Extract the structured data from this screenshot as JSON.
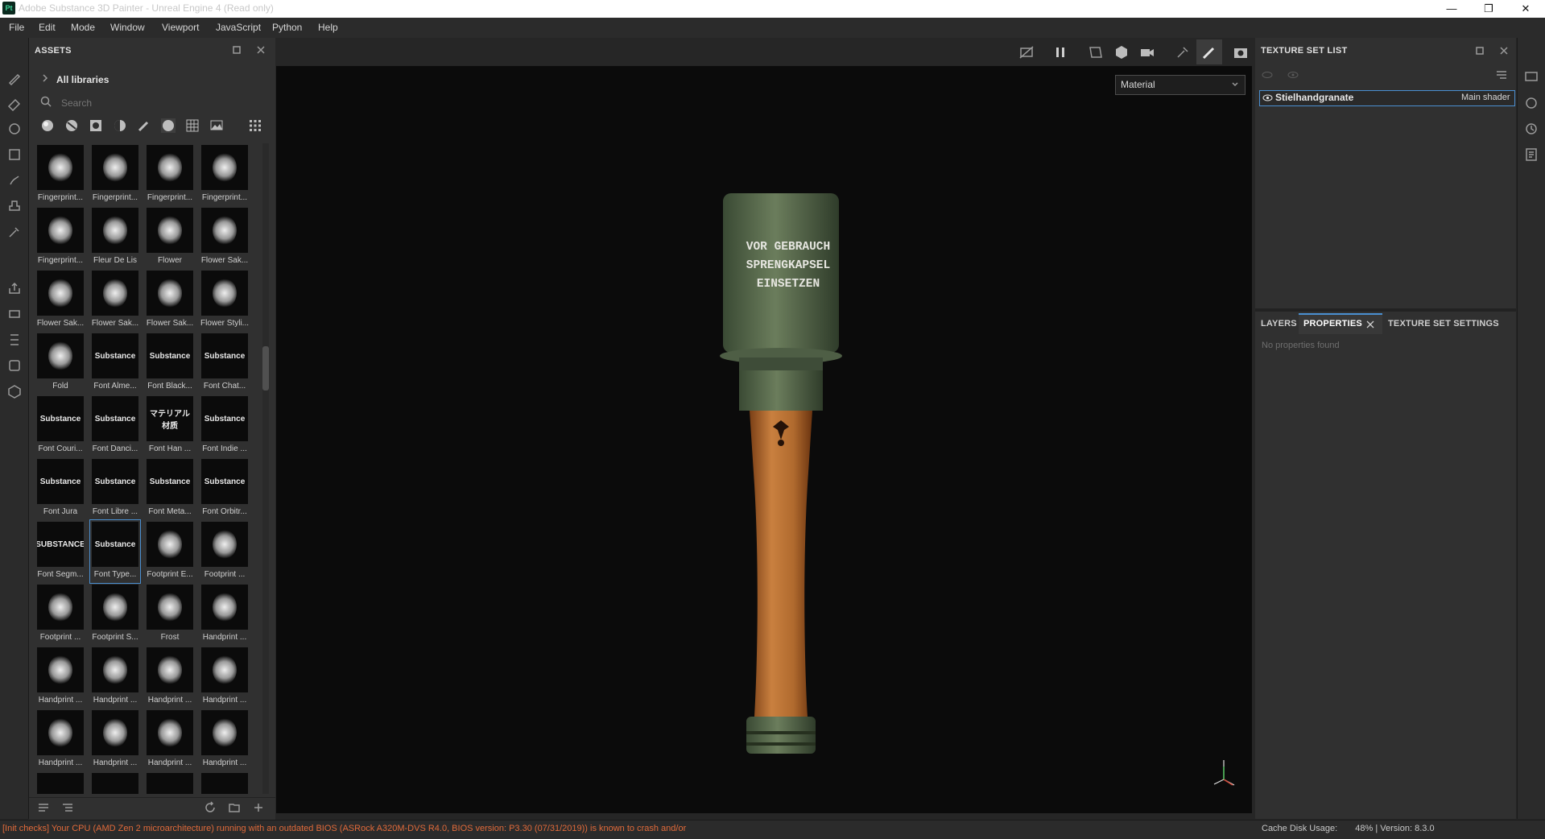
{
  "window": {
    "app_logo": "Pt",
    "title": "Adobe Substance 3D Painter - Unreal Engine 4 (Read only)",
    "controls": {
      "minimize": "—",
      "maximize": "❐",
      "close": "✕"
    }
  },
  "menu": [
    "File",
    "Edit",
    "Mode",
    "Window",
    "Viewport",
    "JavaScript",
    "Python",
    "Help"
  ],
  "left_toolbar_icons": [
    "paint-brush-icon",
    "eraser-icon",
    "projection-icon",
    "geometry-mask-icon",
    "smudge-icon",
    "clone-stamp-icon",
    "color-picker-icon",
    "export-icon",
    "bake-icon",
    "ruler-icon",
    "shelf-icon",
    "3d-icon"
  ],
  "assets": {
    "title": "ASSETS",
    "all_libraries": "All libraries",
    "search_placeholder": "Search",
    "filters": [
      "materials-filter",
      "smart-materials-filter",
      "masks-filter",
      "smart-masks-filter",
      "brushes-filter",
      "alphas-filter",
      "textures-filter",
      "environments-filter"
    ],
    "items": [
      {
        "label": "Fingerprint..."
      },
      {
        "label": "Fingerprint..."
      },
      {
        "label": "Fingerprint..."
      },
      {
        "label": "Fingerprint..."
      },
      {
        "label": "Fingerprint..."
      },
      {
        "label": "Fleur De Lis"
      },
      {
        "label": "Flower"
      },
      {
        "label": "Flower Sak..."
      },
      {
        "label": "Flower Sak..."
      },
      {
        "label": "Flower Sak..."
      },
      {
        "label": "Flower Sak..."
      },
      {
        "label": "Flower Styli..."
      },
      {
        "label": "Fold"
      },
      {
        "label": "Font Alme...",
        "thumb": "Substance"
      },
      {
        "label": "Font Black...",
        "thumb": "Substance"
      },
      {
        "label": "Font Chat...",
        "thumb": "Substance"
      },
      {
        "label": "Font Couri...",
        "thumb": "Substance"
      },
      {
        "label": "Font Danci...",
        "thumb": "Substance"
      },
      {
        "label": "Font Han ...",
        "thumb": "マテリアル材质"
      },
      {
        "label": "Font Indie ...",
        "thumb": "Substance"
      },
      {
        "label": "Font Jura",
        "thumb": "Substance"
      },
      {
        "label": "Font Libre ...",
        "thumb": "Substance"
      },
      {
        "label": "Font Meta...",
        "thumb": "Substance"
      },
      {
        "label": "Font Orbitr...",
        "thumb": "Substance"
      },
      {
        "label": "Font Segm...",
        "thumb": "SUBSTANCE"
      },
      {
        "label": "Font Type...",
        "thumb": "Substance",
        "selected": true
      },
      {
        "label": "Footprint E..."
      },
      {
        "label": "Footprint ..."
      },
      {
        "label": "Footprint ..."
      },
      {
        "label": "Footprint S..."
      },
      {
        "label": "Frost"
      },
      {
        "label": "Handprint ..."
      },
      {
        "label": "Handprint ..."
      },
      {
        "label": "Handprint ..."
      },
      {
        "label": "Handprint ..."
      },
      {
        "label": "Handprint ..."
      },
      {
        "label": "Handprint ..."
      },
      {
        "label": "Handprint ..."
      },
      {
        "label": "Handprint ..."
      },
      {
        "label": "Handprint ..."
      },
      {
        "label": ""
      },
      {
        "label": ""
      },
      {
        "label": ""
      },
      {
        "label": ""
      }
    ]
  },
  "viewport": {
    "material_mode": "Material",
    "model_text": [
      "VOR GEBRAUCH",
      "SPRENGKAPSEL",
      "EINSETZEN"
    ]
  },
  "texture_set_list": {
    "title": "TEXTURE SET LIST",
    "item_name": "Stielhandgranate",
    "item_shader": "Main shader"
  },
  "bottom_tabs": {
    "layers": "LAYERS",
    "properties": "PROPERTIES",
    "texture_set_settings": "TEXTURE SET SETTINGS",
    "no_properties": "No properties found"
  },
  "status": {
    "message": "[Init checks] Your CPU (AMD Zen 2 microarchitecture) running with an outdated BIOS (ASRock A320M-DVS R4.0, BIOS version: P3.30 (07/31/2019)) is known to crash and/or ...",
    "cache_label": "Cache Disk Usage:",
    "cache_value": "48%",
    "version": "Version: 8.3.0"
  }
}
